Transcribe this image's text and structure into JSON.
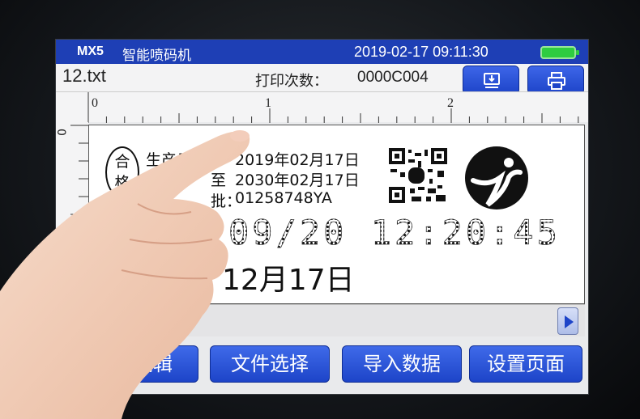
{
  "status": {
    "model": "MX5",
    "app_name": "智能喷码机",
    "datetime": "2019-02-17 09:11:30"
  },
  "info": {
    "filename": "12.txt",
    "print_count_label": "打印次数：",
    "print_count_value": "0000C004"
  },
  "toolbar": {
    "usb_icon": "usb-import-icon",
    "print_icon": "printer-icon"
  },
  "ruler": {
    "h_labels": [
      "0",
      "1",
      "2"
    ],
    "v_labels": [
      "0"
    ]
  },
  "canvas": {
    "stamp": "合\n格",
    "lines": [
      {
        "label": "生产日",
        "value": "2019年02月17日"
      },
      {
        "label": "至",
        "value": "2030年02月17日"
      },
      {
        "label": "批：",
        "value": "01258748YA"
      }
    ],
    "dot_time": "09/20 12:20:45",
    "big_date": "12月17日"
  },
  "bottom": {
    "buttons": [
      "件编辑",
      "文件选择",
      "导入数据",
      "设置页面"
    ]
  },
  "colors": {
    "accent": "#1e3fb5",
    "battery": "#2ecc40"
  }
}
